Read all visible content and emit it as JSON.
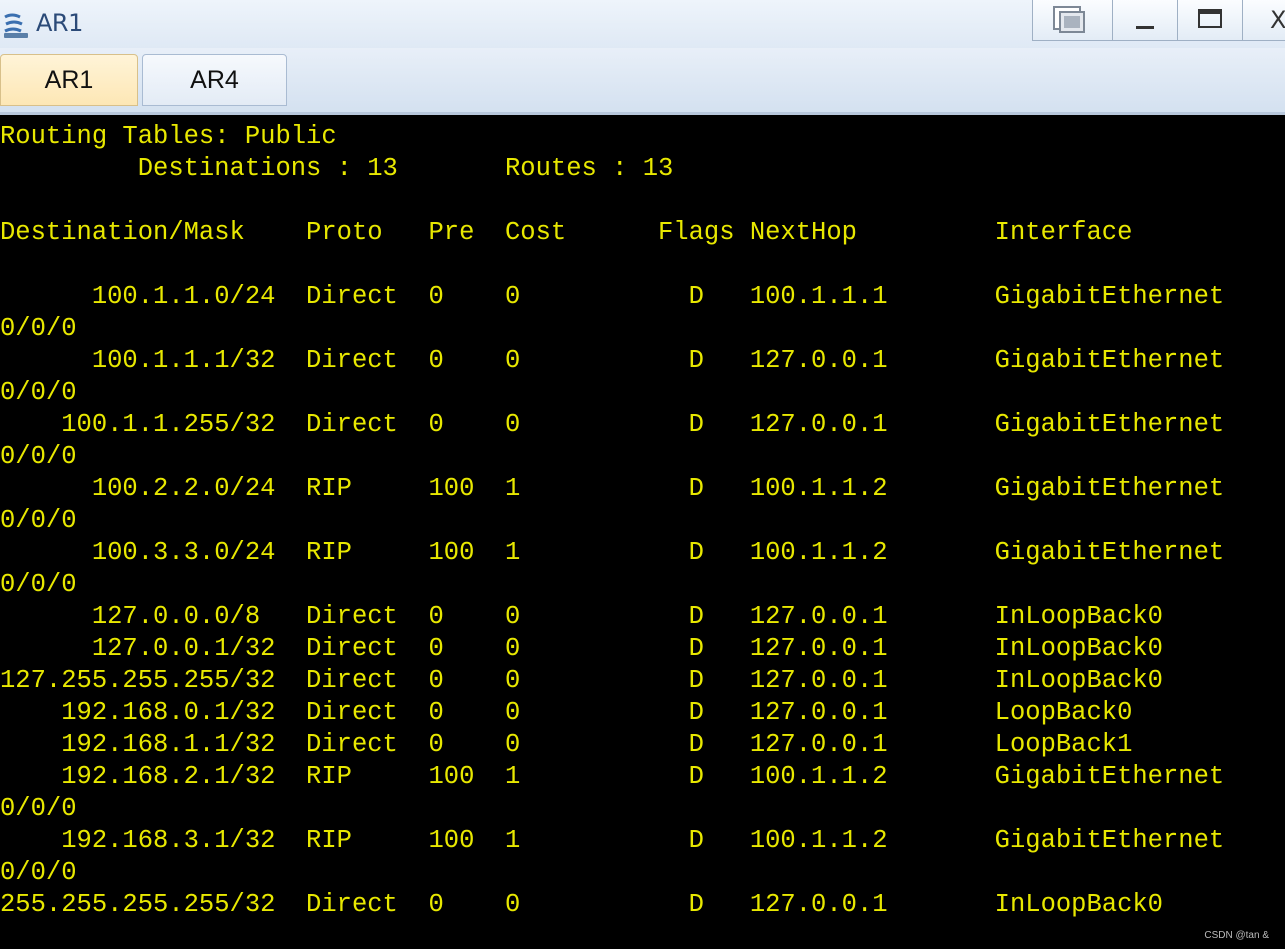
{
  "window": {
    "title": "AR1",
    "icon": "router-icon",
    "close_label": "X"
  },
  "tabs": [
    {
      "label": "AR1",
      "active": true
    },
    {
      "label": "AR4",
      "active": false
    }
  ],
  "console": {
    "lines": [
      "Routing Tables: Public",
      "         Destinations : 13       Routes : 13",
      "",
      "Destination/Mask    Proto   Pre  Cost      Flags NextHop         Interface",
      "",
      "      100.1.1.0/24  Direct  0    0           D   100.1.1.1       GigabitEthernet",
      "0/0/0",
      "      100.1.1.1/32  Direct  0    0           D   127.0.0.1       GigabitEthernet",
      "0/0/0",
      "    100.1.1.255/32  Direct  0    0           D   127.0.0.1       GigabitEthernet",
      "0/0/0",
      "      100.2.2.0/24  RIP     100  1           D   100.1.1.2       GigabitEthernet",
      "0/0/0",
      "      100.3.3.0/24  RIP     100  1           D   100.1.1.2       GigabitEthernet",
      "0/0/0",
      "      127.0.0.0/8   Direct  0    0           D   127.0.0.1       InLoopBack0",
      "      127.0.0.1/32  Direct  0    0           D   127.0.0.1       InLoopBack0",
      "127.255.255.255/32  Direct  0    0           D   127.0.0.1       InLoopBack0",
      "    192.168.0.1/32  Direct  0    0           D   127.0.0.1       LoopBack0",
      "    192.168.1.1/32  Direct  0    0           D   127.0.0.1       LoopBack1",
      "    192.168.2.1/32  RIP     100  1           D   100.1.1.2       GigabitEthernet",
      "0/0/0",
      "    192.168.3.1/32  RIP     100  1           D   100.1.1.2       GigabitEthernet",
      "0/0/0",
      "255.255.255.255/32  Direct  0    0           D   127.0.0.1       InLoopBack0"
    ]
  },
  "watermark": "CSDN @tan &",
  "colors": {
    "console_bg": "#000000",
    "console_fg": "#e8e800",
    "title_fg": "#2b4a78"
  }
}
